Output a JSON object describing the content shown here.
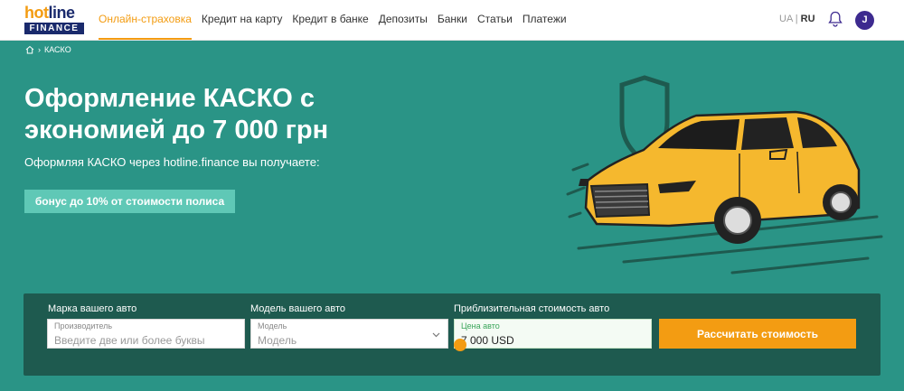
{
  "header": {
    "logo_top_a": "hot",
    "logo_top_b": "line",
    "logo_bottom": "FINANCE",
    "nav": [
      {
        "label": "Онлайн-страховка",
        "active": true
      },
      {
        "label": "Кредит на карту"
      },
      {
        "label": "Кредит в банке"
      },
      {
        "label": "Депозиты"
      },
      {
        "label": "Банки"
      },
      {
        "label": "Статьи"
      },
      {
        "label": "Платежи"
      }
    ],
    "lang_ua": "UA",
    "lang_sep": "|",
    "lang_ru": "RU",
    "avatar_initial": "J"
  },
  "breadcrumb": {
    "current": "КАСКО"
  },
  "hero": {
    "title": "Оформление КАСКО с экономией до 7 000 грн",
    "subtitle": "Оформляя КАСКО через hotline.finance вы получаете:",
    "badge": "бонус до 10% от стоимости полиса"
  },
  "form": {
    "maker_label": "Марка вашего авто",
    "maker_small": "Производитель",
    "maker_placeholder": "Введите две или более буквы",
    "model_label": "Модель вашего авто",
    "model_small": "Модель",
    "model_placeholder": "Модель",
    "price_label": "Приблизительная стоимость авто",
    "price_small": "Цена авто",
    "price_value": "7 000 USD",
    "submit": "Рассчитать стоимость"
  },
  "colors": {
    "accent": "#f39c12",
    "hero_bg": "#2a9486",
    "form_bg": "#1e5a4f",
    "badge_bg": "#5fc8b6",
    "brand_navy": "#1a2a6c"
  },
  "icons": [
    "home-icon",
    "bell-icon",
    "chevron-down-icon",
    "shield-icon",
    "car-illustration"
  ]
}
